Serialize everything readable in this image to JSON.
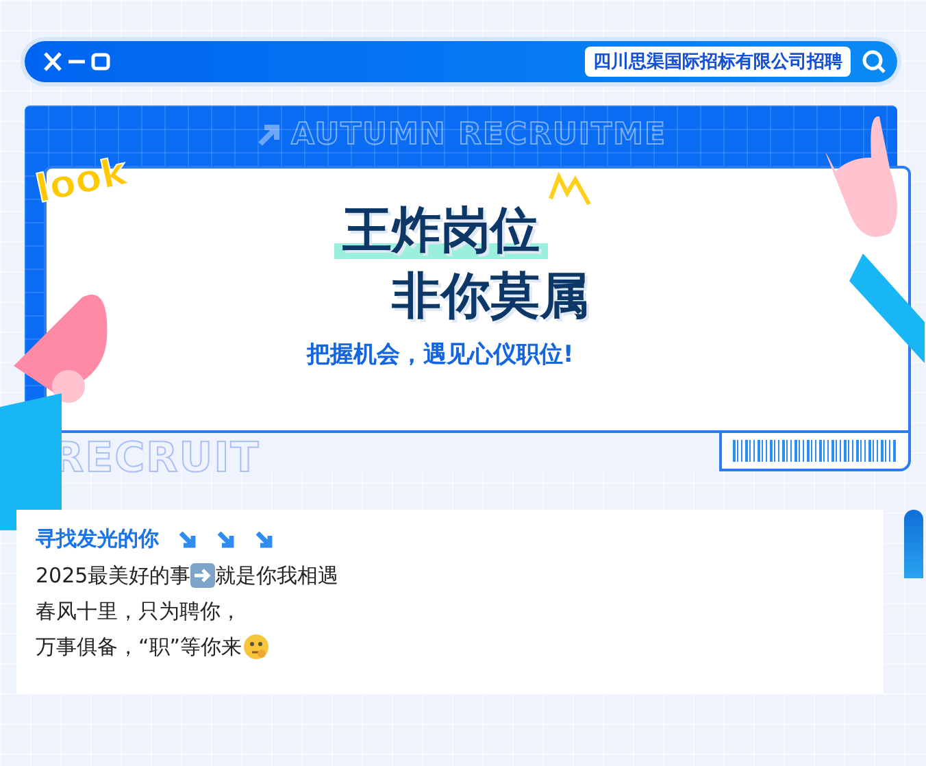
{
  "title_bar": {
    "label": "四川思渠国际招标有限公司招聘"
  },
  "banner": {
    "watermark_top": "AUTUMN RECRUITME",
    "sticker": "look",
    "headline": [
      "王炸岗位",
      "非你莫属"
    ],
    "tagline": "把握机会，遇见心仪职位!",
    "watermark_bottom": "RECRUIT"
  },
  "intro": {
    "heading": "寻找发光的你",
    "lines": [
      {
        "kind": "arrow",
        "text": "2025最美好的事",
        "after": "就是你我相遇"
      },
      {
        "kind": "plain",
        "text": "春风十里，只为聘你，"
      },
      {
        "kind": "emoji",
        "text": "万事俱备，“职”等你来"
      }
    ]
  }
}
